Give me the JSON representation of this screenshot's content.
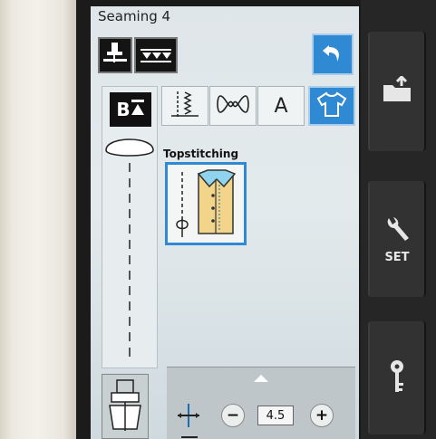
{
  "screen": {
    "title": "Seaming 4"
  },
  "top_buttons": [
    {
      "name": "presser-foot-setting-icon"
    },
    {
      "name": "feed-dog-icon"
    }
  ],
  "back_button": {
    "icon": "back-arrow-icon"
  },
  "left_panel": {
    "b_icon_label": "B",
    "stitch_preview": "straight-stitch-preview"
  },
  "category_tabs": [
    {
      "name": "utility-stitch-tab",
      "icon": "utility-stitch-icon",
      "selected": false
    },
    {
      "name": "decorative-stitch-tab",
      "icon": "decorative-stitch-icon",
      "selected": false
    },
    {
      "name": "alphabet-tab",
      "label": "A",
      "selected": false
    },
    {
      "name": "garment-tab",
      "icon": "shirt-icon",
      "selected": true
    }
  ],
  "category": {
    "label": "Topstitching"
  },
  "stitch_tile": {
    "icon": "topstitching-shirt-icon",
    "selected": true
  },
  "settings_panel": {
    "expand_icon": "up-arrow-icon",
    "stitch_width": {
      "icon": "stitch-width-icon",
      "minus_label": "−",
      "plus_label": "+",
      "value": "4.5"
    }
  },
  "side_buttons": [
    {
      "name": "save-button",
      "icon": "folder-save-icon"
    },
    {
      "name": "settings-button",
      "icon": "wrench-icon",
      "label": "SET"
    },
    {
      "name": "lock-button",
      "icon": "key-icon"
    }
  ],
  "colors": {
    "accent_blue": "#2f8ad3",
    "screen_bg": "#dfe6e9",
    "bezel": "#1b1b1b"
  }
}
